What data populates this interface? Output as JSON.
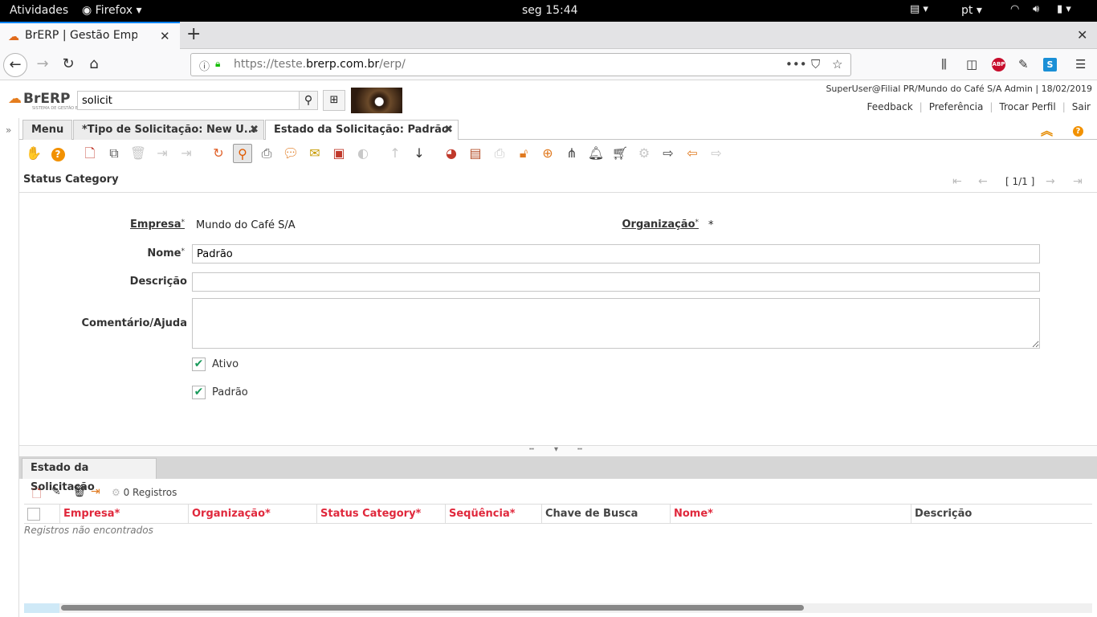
{
  "gnome": {
    "activities": "Atividades",
    "app": "Firefox ▾",
    "clock": "seg 15:44",
    "lang": "pt ▾"
  },
  "browser": {
    "tab_title": "BrERP | Gestão Empresarial",
    "url_host_pre": "https://teste.",
    "url_host": "brerp.com.br",
    "url_path": "/erp/"
  },
  "header": {
    "logo": "BrERP",
    "logo_sub": "SISTEMA DE GESTÃO EMPRESARIAL",
    "search_value": "solicit",
    "user_info": "SuperUser@Filial PR/Mundo do Café S/A Admin | 18/02/2019",
    "links": [
      "Feedback",
      "Preferência",
      "Trocar Perfil",
      "Sair"
    ]
  },
  "window_tabs": [
    {
      "label": "Menu"
    },
    {
      "label": "*Tipo de Solicitação: New U..."
    },
    {
      "label": "Estado da Solicitação: Padrão"
    }
  ],
  "form": {
    "title": "Status Category",
    "pager": "[ 1/1 ]",
    "empresa_label": "Empresa",
    "empresa_value": "Mundo do Café S/A",
    "org_label": "Organização",
    "org_value": "*",
    "nome_label": "Nome",
    "nome_value": "Padrão",
    "descricao_label": "Descrição",
    "descricao_value": "",
    "comentario_label": "Comentário/Ajuda",
    "comentario_value": "",
    "ativo_label": "Ativo",
    "ativo_checked": true,
    "padrao_label": "Padrão",
    "padrao_checked": true
  },
  "detail": {
    "tab_label": "Estado da Solicitação",
    "record_count": "0 Registros",
    "columns": [
      {
        "label": "Empresa*",
        "required": true
      },
      {
        "label": "Organização*",
        "required": true
      },
      {
        "label": "Status Category*",
        "required": true
      },
      {
        "label": "Seqüência*",
        "required": true
      },
      {
        "label": "Chave de Busca",
        "required": false
      },
      {
        "label": "Nome*",
        "required": true
      },
      {
        "label": "Descrição",
        "required": false
      }
    ],
    "empty_message": "Registros não encontrados"
  },
  "colors": {
    "accent": "#f29100",
    "required": "#e0283c",
    "check": "#1a9a5b"
  }
}
